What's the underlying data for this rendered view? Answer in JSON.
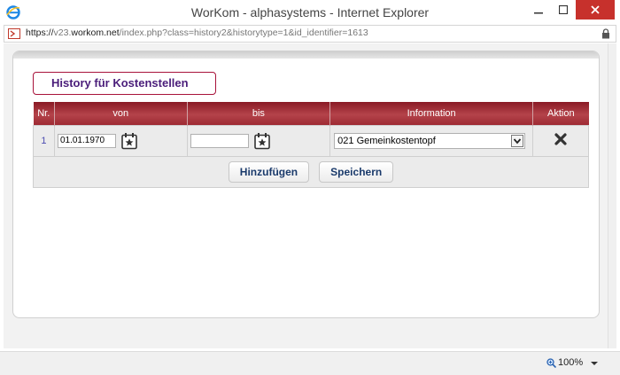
{
  "window": {
    "title": "WorKom - alphasystems - Internet Explorer"
  },
  "address": {
    "protocol": "https://",
    "prefix": "v23.",
    "domain": "workom.net",
    "path": "/index.php?class=history2&historytype=1&id_identifier=1613"
  },
  "section": {
    "title": "History für Kostenstellen"
  },
  "table": {
    "columns": [
      "Nr.",
      "von",
      "bis",
      "Information",
      "Aktion"
    ],
    "rows": [
      {
        "nr": "1",
        "von": "01.01.1970",
        "bis": "",
        "information": "021 Gemeinkostentopf"
      }
    ]
  },
  "buttons": {
    "add": "Hinzufügen",
    "save": "Speichern"
  },
  "status": {
    "zoom": "100%"
  },
  "colors": {
    "header_red": "#9e2a33",
    "title_purple": "#4a1d7a",
    "close_red": "#c7312c"
  }
}
